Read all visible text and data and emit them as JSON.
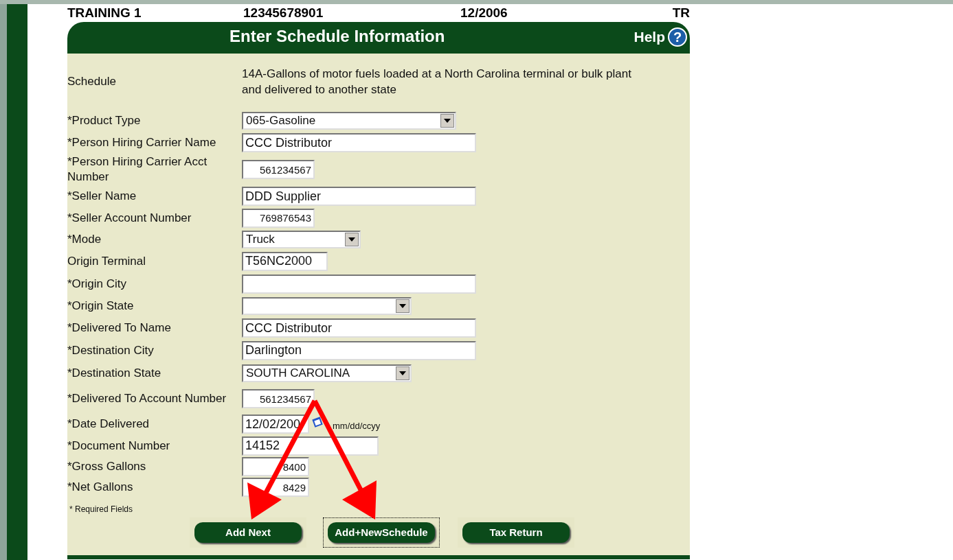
{
  "header": {
    "name": "TRAINING 1",
    "account": "12345678901",
    "period": "12/2006",
    "type": "TR"
  },
  "title": "Enter Schedule Information",
  "help": {
    "label": "Help",
    "icon": "?"
  },
  "schedule": {
    "label": "Schedule",
    "text": "14A-Gallons of motor fuels loaded at a North Carolina terminal or bulk plant and delivered to another state"
  },
  "fields": [
    {
      "label": "*Product Type",
      "kind": "select",
      "value": "065-Gasoline"
    },
    {
      "label": "*Person Hiring Carrier Name",
      "kind": "text",
      "value": "CCC Distributor"
    },
    {
      "label": "*Person Hiring Carrier Acct Number",
      "kind": "number",
      "value": "561234567"
    },
    {
      "label": "*Seller Name",
      "kind": "text",
      "value": "DDD Supplier"
    },
    {
      "label": "*Seller Account Number",
      "kind": "number",
      "value": "769876543"
    },
    {
      "label": "*Mode",
      "kind": "select",
      "value": "Truck"
    },
    {
      "label": "Origin Terminal",
      "kind": "text",
      "value": "T56NC2000"
    },
    {
      "label": "*Origin City",
      "kind": "text"
    },
    {
      "label": "*Origin State",
      "kind": "select"
    },
    {
      "label": "*Delivered To Name",
      "kind": "text",
      "value": "CCC Distributor"
    },
    {
      "label": "*Destination City",
      "kind": "text",
      "value": "Darlington"
    },
    {
      "label": "*Destination State",
      "kind": "select",
      "value": "SOUTH CAROLINA"
    },
    {
      "label": "*Delivered To Account Number",
      "kind": "number",
      "value": "561234567"
    },
    {
      "label": "*Date Delivered",
      "kind": "date",
      "value": "12/02/200",
      "hint": "mm/dd/ccyy"
    },
    {
      "label": "*Document Number",
      "kind": "text",
      "value": "14152"
    },
    {
      "label": "*Gross Gallons",
      "kind": "number",
      "value": "8400"
    },
    {
      "label": "*Net Gallons",
      "kind": "number",
      "value": "8429"
    }
  ],
  "required_note": "* Required Fields",
  "buttons": [
    {
      "label": "Add Next",
      "focused": false
    },
    {
      "label": "Add+NewSchedule",
      "focused": true
    },
    {
      "label": "Tax Return",
      "focused": false
    }
  ]
}
